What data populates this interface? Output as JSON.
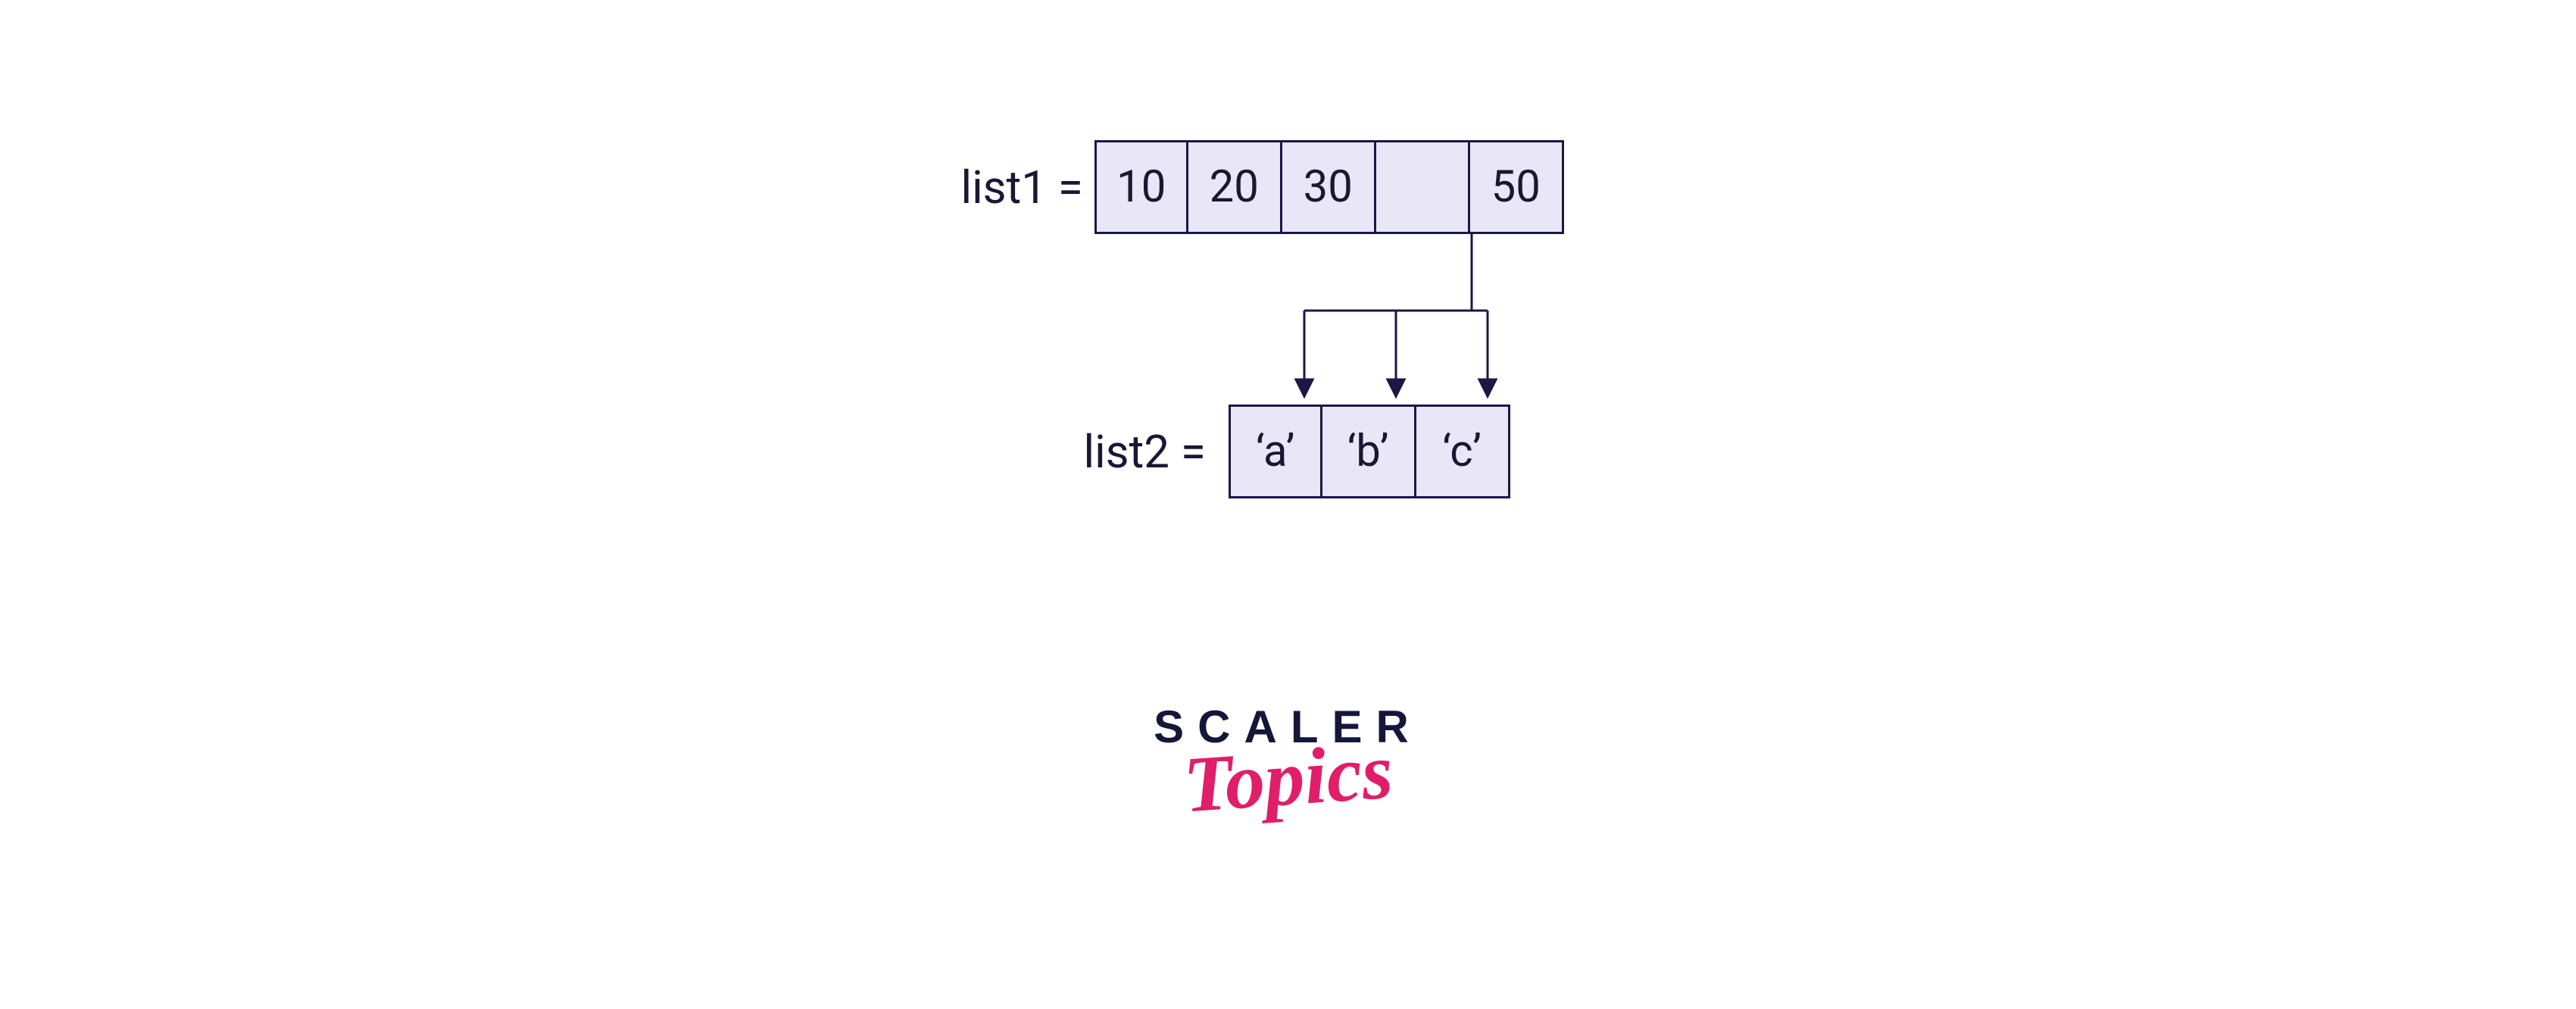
{
  "list1": {
    "label": "list1 = ",
    "cells": [
      "10",
      "20",
      "30",
      "",
      "50"
    ]
  },
  "list2": {
    "label": "list2 =  ",
    "cells": [
      "‘a’",
      "‘b’",
      "‘c’"
    ]
  },
  "brand": {
    "scaler": "SCALER",
    "topics": "Topics"
  },
  "colors": {
    "stroke": "#1b1845",
    "fill": "#e9e6f7",
    "accent": "#e01e6a"
  }
}
